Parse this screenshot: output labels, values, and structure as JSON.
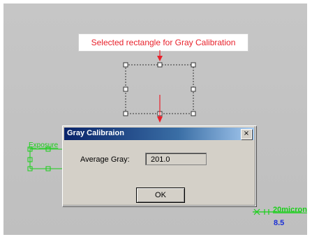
{
  "image": {
    "callout_text": "Selected rectangle for Gray Calibration",
    "exposure_label": "Exposure",
    "scale_label": "20micron",
    "scale_value": "8.5"
  },
  "dialog": {
    "title": "Gray Calibraion",
    "close_label": "×",
    "average_gray_label": "Average Gray:",
    "average_gray_value": "201.0",
    "ok_label": "OK"
  },
  "colors": {
    "callout_text": "#e8202a",
    "arrow": "#e8202a",
    "overlay_green": "#19d019",
    "scale_value": "#1a2fd6",
    "titlebar_start": "#0a246a",
    "titlebar_end": "#a6caf0"
  }
}
